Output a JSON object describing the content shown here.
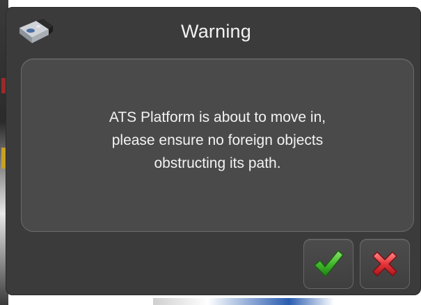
{
  "dialog": {
    "title": "Warning",
    "app_icon": "camera-icon",
    "message_lines": [
      "ATS Platform is about to move in,",
      "please ensure no foreign objects",
      "obstructing its path."
    ],
    "confirm_icon": "checkmark-icon",
    "cancel_icon": "close-x-icon"
  },
  "colors": {
    "dialog_background": "#3b3b3b",
    "panel_background": "#4a4a4a",
    "text": "#f2f2f2",
    "confirm_green": "#3fb52a",
    "cancel_red": "#e5353a"
  }
}
